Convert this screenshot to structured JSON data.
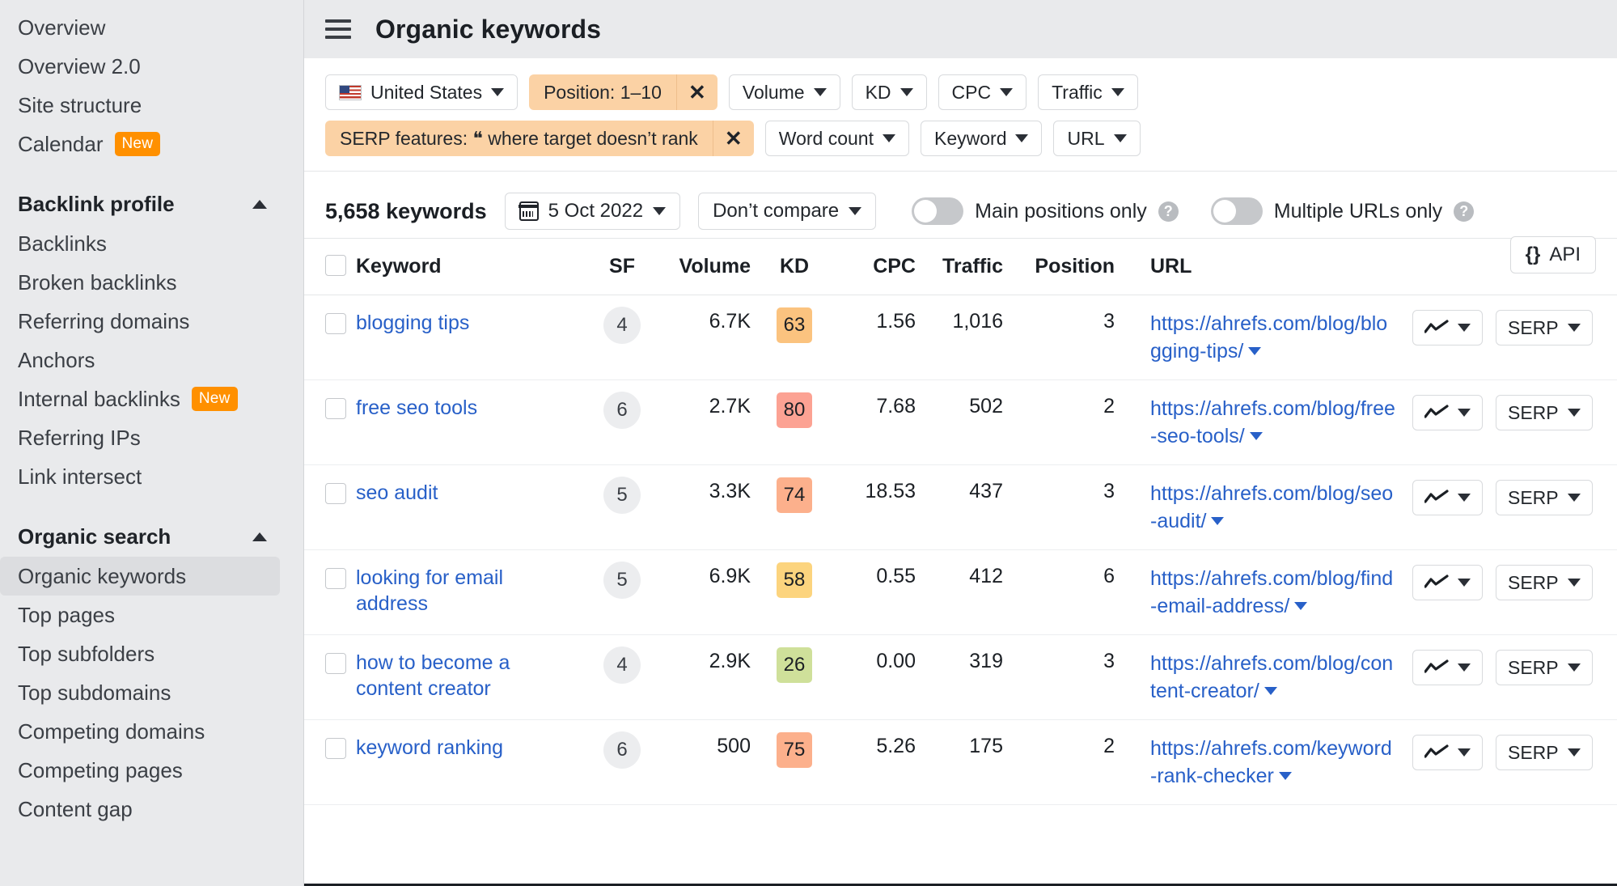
{
  "sidebar": {
    "items": [
      {
        "label": "Overview",
        "badge": null,
        "active": false,
        "type": "item"
      },
      {
        "label": "Overview 2.0",
        "badge": null,
        "active": false,
        "type": "item"
      },
      {
        "label": "Site structure",
        "badge": null,
        "active": false,
        "type": "item"
      },
      {
        "label": "Calendar",
        "badge": "New",
        "active": false,
        "type": "item"
      },
      {
        "label": "Backlink profile",
        "badge": null,
        "active": false,
        "type": "group"
      },
      {
        "label": "Backlinks",
        "badge": null,
        "active": false,
        "type": "item"
      },
      {
        "label": "Broken backlinks",
        "badge": null,
        "active": false,
        "type": "item"
      },
      {
        "label": "Referring domains",
        "badge": null,
        "active": false,
        "type": "item"
      },
      {
        "label": "Anchors",
        "badge": null,
        "active": false,
        "type": "item"
      },
      {
        "label": "Internal backlinks",
        "badge": "New",
        "active": false,
        "type": "item"
      },
      {
        "label": "Referring IPs",
        "badge": null,
        "active": false,
        "type": "item"
      },
      {
        "label": "Link intersect",
        "badge": null,
        "active": false,
        "type": "item"
      },
      {
        "label": "Organic search",
        "badge": null,
        "active": false,
        "type": "group"
      },
      {
        "label": "Organic keywords",
        "badge": null,
        "active": true,
        "type": "item"
      },
      {
        "label": "Top pages",
        "badge": null,
        "active": false,
        "type": "item"
      },
      {
        "label": "Top subfolders",
        "badge": null,
        "active": false,
        "type": "item"
      },
      {
        "label": "Top subdomains",
        "badge": null,
        "active": false,
        "type": "item"
      },
      {
        "label": "Competing domains",
        "badge": null,
        "active": false,
        "type": "item"
      },
      {
        "label": "Competing pages",
        "badge": null,
        "active": false,
        "type": "item"
      },
      {
        "label": "Content gap",
        "badge": null,
        "active": false,
        "type": "item"
      }
    ]
  },
  "header": {
    "title": "Organic keywords",
    "menu_icon": "hamburger-icon"
  },
  "filters": {
    "row1": [
      {
        "label": "United States",
        "style": "default",
        "icon": "us-flag-icon",
        "caret": true,
        "close": false
      },
      {
        "label": "Position: 1–10",
        "style": "active",
        "icon": null,
        "caret": false,
        "close": true
      },
      {
        "label": "Volume",
        "style": "default",
        "icon": null,
        "caret": true,
        "close": false
      },
      {
        "label": "KD",
        "style": "default",
        "icon": null,
        "caret": true,
        "close": false
      },
      {
        "label": "CPC",
        "style": "default",
        "icon": null,
        "caret": true,
        "close": false
      },
      {
        "label": "Traffic",
        "style": "default",
        "icon": null,
        "caret": true,
        "close": false
      }
    ],
    "row2": [
      {
        "label": "SERP features: ❝ where target doesn’t rank",
        "style": "active",
        "icon": "quote-icon",
        "caret": false,
        "close": true
      },
      {
        "label": "Word count",
        "style": "default",
        "icon": null,
        "caret": true,
        "close": false
      },
      {
        "label": "Keyword",
        "style": "default",
        "icon": null,
        "caret": true,
        "close": false
      },
      {
        "label": "URL",
        "style": "default",
        "icon": null,
        "caret": true,
        "close": false
      }
    ],
    "active_chip_color": "#fbd2a5",
    "close_label": "✕"
  },
  "toolbar": {
    "keyword_count": "5,658 keywords",
    "date_label": "5 Oct 2022",
    "compare_label": "Don’t compare",
    "toggle_main_positions": {
      "label": "Main positions only",
      "on": false
    },
    "toggle_multiple_urls": {
      "label": "Multiple URLs only",
      "on": false
    },
    "api_label": "API",
    "api_glyph": "{}",
    "help_glyph": "?"
  },
  "table": {
    "columns": [
      "Keyword",
      "SF",
      "Volume",
      "KD",
      "CPC",
      "Traffic",
      "Position",
      "URL"
    ],
    "action_serp_label": "SERP",
    "rows": [
      {
        "keyword": "blogging tips",
        "sf": "4",
        "volume": "6.7K",
        "kd": "63",
        "kd_color": "#fbc37f",
        "cpc": "1.56",
        "traffic": "1,016",
        "position": "3",
        "url": "https://ahrefs.com/blog/blogging-tips/"
      },
      {
        "keyword": "free seo tools",
        "sf": "6",
        "volume": "2.7K",
        "kd": "80",
        "kd_color": "#fca293",
        "cpc": "7.68",
        "traffic": "502",
        "position": "2",
        "url": "https://ahrefs.com/blog/free-seo-tools/"
      },
      {
        "keyword": "seo audit",
        "sf": "5",
        "volume": "3.3K",
        "kd": "74",
        "kd_color": "#fcb08c",
        "cpc": "18.53",
        "traffic": "437",
        "position": "3",
        "url": "https://ahrefs.com/blog/seo-audit/"
      },
      {
        "keyword": "looking for email address",
        "sf": "5",
        "volume": "6.9K",
        "kd": "58",
        "kd_color": "#fcd47e",
        "cpc": "0.55",
        "traffic": "412",
        "position": "6",
        "url": "https://ahrefs.com/blog/find-email-address/"
      },
      {
        "keyword": "how to become a content creator",
        "sf": "4",
        "volume": "2.9K",
        "kd": "26",
        "kd_color": "#cfe09a",
        "cpc": "0.00",
        "traffic": "319",
        "position": "3",
        "url": "https://ahrefs.com/blog/content-creator/"
      },
      {
        "keyword": "keyword ranking",
        "sf": "6",
        "volume": "500",
        "kd": "75",
        "kd_color": "#fcb08c",
        "cpc": "5.26",
        "traffic": "175",
        "position": "2",
        "url": "https://ahrefs.com/keyword-rank-checker"
      }
    ]
  }
}
